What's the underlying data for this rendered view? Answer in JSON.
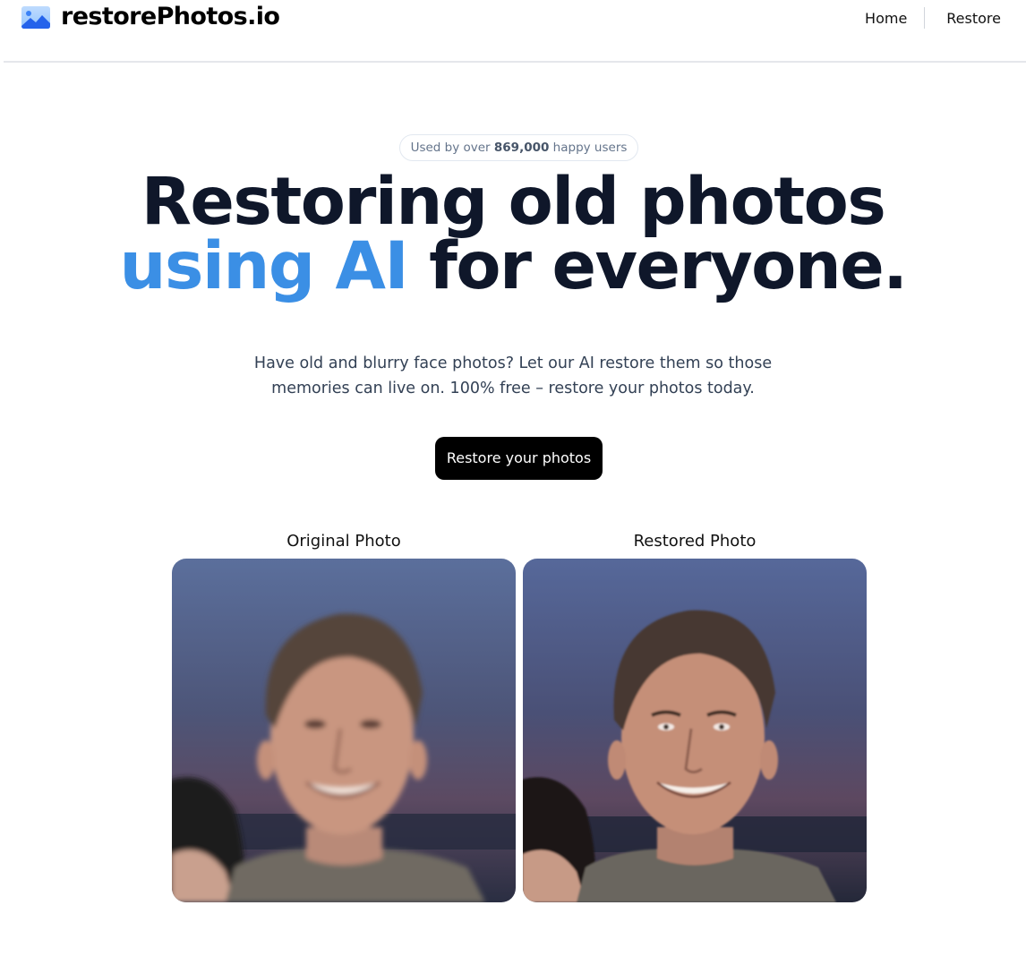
{
  "header": {
    "logo_text": "restorePhotos.io",
    "logo_icon": "image-icon",
    "nav": [
      {
        "label": "Home"
      },
      {
        "label": "Restore"
      }
    ]
  },
  "hero": {
    "badge_prefix": "Used by over ",
    "badge_count": "869,000",
    "badge_suffix": " happy users",
    "title_line1": "Restoring old photos",
    "title_accent": "using AI",
    "title_rest": " for everyone.",
    "subtitle": "Have old and blurry face photos? Let our AI restore them so those memories can live on. 100% free – restore your photos today.",
    "cta_label": "Restore your photos",
    "accent_color": "#3b8fe5"
  },
  "comparison": {
    "original_label": "Original Photo",
    "restored_label": "Restored Photo"
  }
}
